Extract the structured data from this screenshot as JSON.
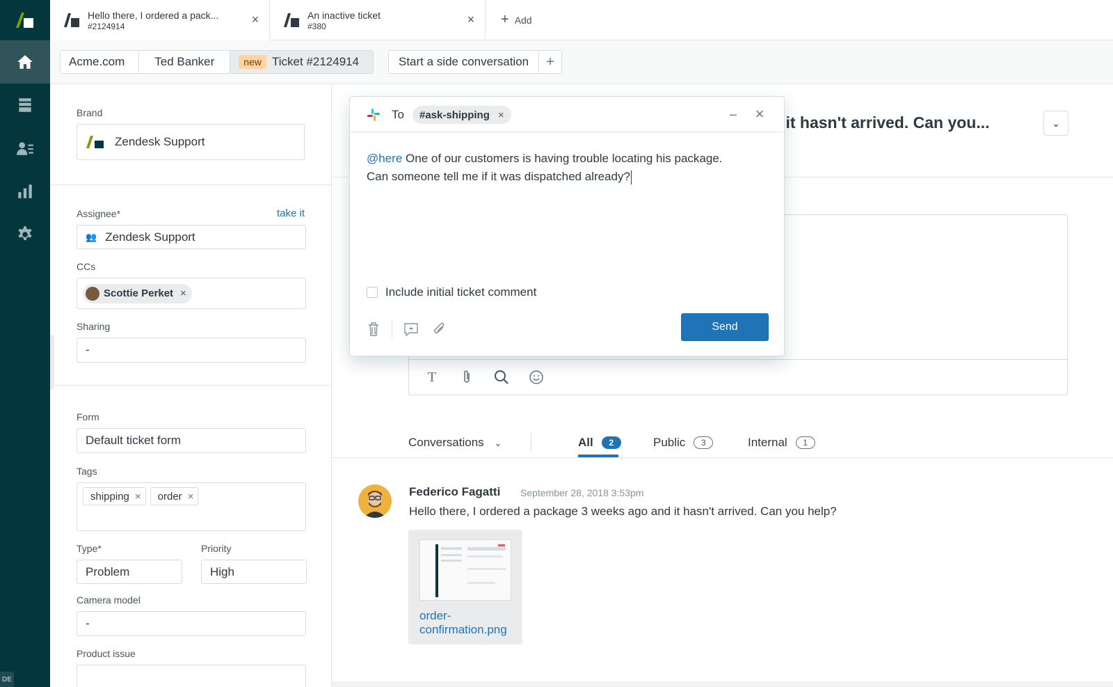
{
  "colors": {
    "nav_bg": "#03363d",
    "nav_active": "#30545a",
    "accent_blue": "#1f73b7",
    "new_badge": "#ffd4a1"
  },
  "nav": {
    "items": [
      {
        "name": "home",
        "icon": "home-icon",
        "active": true
      },
      {
        "name": "views",
        "icon": "views-icon",
        "active": false
      },
      {
        "name": "customers",
        "icon": "customers-icon",
        "active": false
      },
      {
        "name": "reporting",
        "icon": "bar-chart-icon",
        "active": false
      },
      {
        "name": "admin",
        "icon": "gear-icon",
        "active": false
      }
    ],
    "corner_label": "DE"
  },
  "tabs": [
    {
      "title": "Hello there, I ordered a pack...",
      "sub": "#2124914"
    },
    {
      "title": "An inactive ticket",
      "sub": "#380"
    }
  ],
  "add_tab_label": "Add",
  "breadcrumbs": {
    "org": "Acme.com",
    "requester": "Ted Banker",
    "status_badge": "new",
    "ticket": "Ticket #2124914"
  },
  "side_conversation_button": "Start a side conversation",
  "props": {
    "brand_label": "Brand",
    "brand_value": "Zendesk Support",
    "assignee_label": "Assignee*",
    "take_it": "take it",
    "assignee_value": "Zendesk Support",
    "ccs_label": "CCs",
    "cc_person": "Scottie Perket",
    "sharing_label": "Sharing",
    "sharing_value": "-",
    "form_label": "Form",
    "form_value": "Default ticket form",
    "tags_label": "Tags",
    "tags": [
      "shipping",
      "order"
    ],
    "type_label": "Type*",
    "type_value": "Problem",
    "priority_label": "Priority",
    "priority_value": "High",
    "camera_label": "Camera model",
    "camera_value": "-",
    "product_label": "Product issue"
  },
  "main": {
    "subject_visible": "nd it hasn't arrived. Can you...",
    "conversations_dropdown": "Conversations",
    "filters": [
      {
        "label": "All",
        "count": "2",
        "active": true
      },
      {
        "label": "Public",
        "count": "3",
        "active": false
      },
      {
        "label": "Internal",
        "count": "1",
        "active": false
      }
    ],
    "message": {
      "author": "Federico Fagatti",
      "time": "September 28, 2018 3:53pm",
      "body": "Hello there, I ordered a package 3 weeks ago and it hasn't arrived. Can you help?",
      "attachment": "order-confirmation.png"
    },
    "composer_tools": [
      "text-format-icon",
      "attachment-icon",
      "search-icon",
      "emoji-icon"
    ]
  },
  "popup": {
    "to_label": "To",
    "recipient": "#ask-shipping",
    "mention": "@here",
    "body_line1": " One of our customers is having trouble locating his package.",
    "body_line2": "Can someone tell me if it was dispatched already?",
    "include_label": "Include initial ticket comment",
    "send_label": "Send"
  }
}
